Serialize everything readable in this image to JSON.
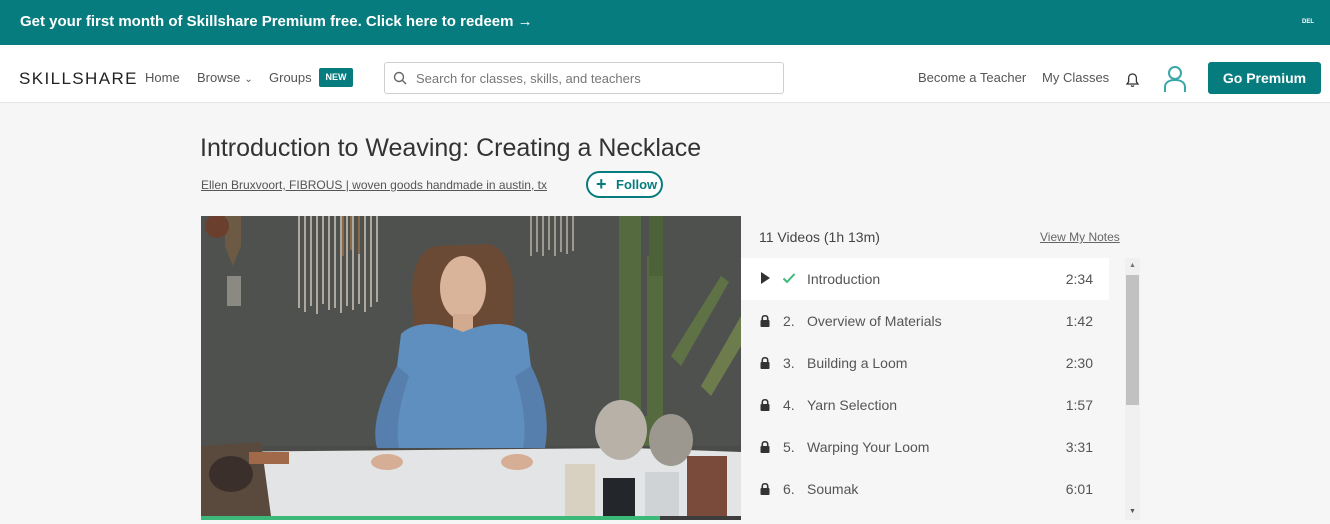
{
  "promo": {
    "text": "Get your first month of Skillshare Premium free. Click here to redeem →",
    "del": "DEL"
  },
  "nav": {
    "logo": "SKILLSHARE",
    "home": "Home",
    "browse": "Browse",
    "groups": "Groups",
    "new_badge": "NEW",
    "search_placeholder": "Search for classes, skills, and teachers",
    "become_teacher": "Become a Teacher",
    "my_classes": "My Classes",
    "go_premium": "Go Premium"
  },
  "class": {
    "title": "Introduction to Weaving: Creating a Necklace",
    "teacher": "Ellen Bruxvoort, FIBROUS | woven goods handmade in austin, tx",
    "follow": "Follow",
    "progress_fraction": 0.85
  },
  "playlist": {
    "count": "11 Videos (1h 13m)",
    "notes": "View My Notes",
    "lessons": [
      {
        "num": "",
        "name": "Introduction",
        "duration": "2:34",
        "state": "playing"
      },
      {
        "num": "2.",
        "name": "Overview of Materials",
        "duration": "1:42",
        "state": "locked"
      },
      {
        "num": "3.",
        "name": "Building a Loom",
        "duration": "2:30",
        "state": "locked"
      },
      {
        "num": "4.",
        "name": "Yarn Selection",
        "duration": "1:57",
        "state": "locked"
      },
      {
        "num": "5.",
        "name": "Warping Your Loom",
        "duration": "3:31",
        "state": "locked"
      },
      {
        "num": "6.",
        "name": "Soumak",
        "duration": "6:01",
        "state": "locked"
      }
    ]
  },
  "colors": {
    "brand": "#077c7f",
    "check": "#3cb878"
  }
}
